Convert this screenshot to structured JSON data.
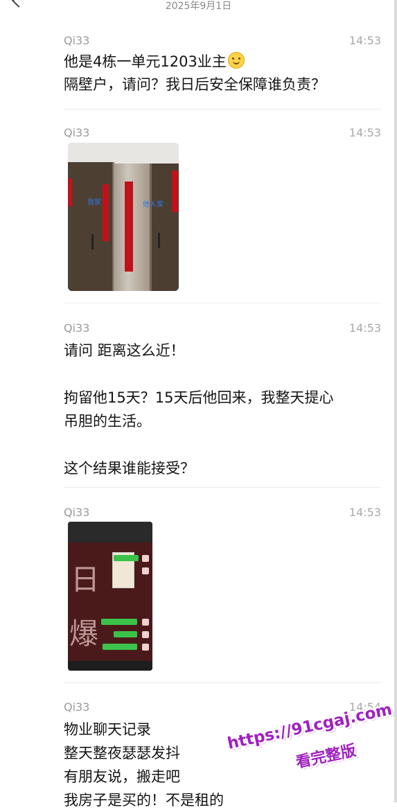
{
  "header": {
    "date": "2025年9月1日"
  },
  "messages": [
    {
      "sender": "Qi33",
      "time": "14:53",
      "lines": [
        "他是4栋一单元1203业主",
        "隔壁户，请问？我日后安全保障谁负责？"
      ],
      "emoji": "smiley-icon"
    },
    {
      "sender": "Qi33",
      "time": "14:53",
      "image": {
        "label_left": "我家",
        "label_right": "他人家"
      }
    },
    {
      "sender": "Qi33",
      "time": "14:53",
      "text": "请问 距离这么近！\n\n拘留他15天？15天后他回来，我整天提心\n吊胆的生活。\n\n这个结果谁能接受？"
    },
    {
      "sender": "Qi33",
      "time": "14:53",
      "image": {
        "big1": "日",
        "big2": "爆"
      }
    },
    {
      "sender": "Qi33",
      "time": "14:54",
      "text": "物业聊天记录\n整天整夜瑟瑟发抖\n有朋友说，搬走吧\n我房子是买的！不是租的"
    }
  ],
  "watermark": {
    "line1": "https://91cgaj.com",
    "line2": "看完整版"
  }
}
